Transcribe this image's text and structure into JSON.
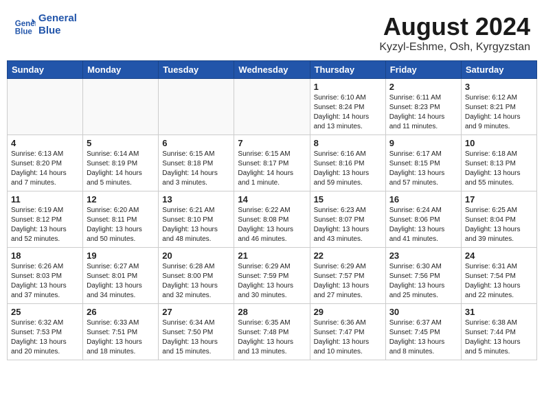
{
  "header": {
    "logo_line1": "General",
    "logo_line2": "Blue",
    "month_year": "August 2024",
    "location": "Kyzyl-Eshme, Osh, Kyrgyzstan"
  },
  "weekdays": [
    "Sunday",
    "Monday",
    "Tuesday",
    "Wednesday",
    "Thursday",
    "Friday",
    "Saturday"
  ],
  "weeks": [
    [
      {
        "day": "",
        "info": ""
      },
      {
        "day": "",
        "info": ""
      },
      {
        "day": "",
        "info": ""
      },
      {
        "day": "",
        "info": ""
      },
      {
        "day": "1",
        "info": "Sunrise: 6:10 AM\nSunset: 8:24 PM\nDaylight: 14 hours\nand 13 minutes."
      },
      {
        "day": "2",
        "info": "Sunrise: 6:11 AM\nSunset: 8:23 PM\nDaylight: 14 hours\nand 11 minutes."
      },
      {
        "day": "3",
        "info": "Sunrise: 6:12 AM\nSunset: 8:21 PM\nDaylight: 14 hours\nand 9 minutes."
      }
    ],
    [
      {
        "day": "4",
        "info": "Sunrise: 6:13 AM\nSunset: 8:20 PM\nDaylight: 14 hours\nand 7 minutes."
      },
      {
        "day": "5",
        "info": "Sunrise: 6:14 AM\nSunset: 8:19 PM\nDaylight: 14 hours\nand 5 minutes."
      },
      {
        "day": "6",
        "info": "Sunrise: 6:15 AM\nSunset: 8:18 PM\nDaylight: 14 hours\nand 3 minutes."
      },
      {
        "day": "7",
        "info": "Sunrise: 6:15 AM\nSunset: 8:17 PM\nDaylight: 14 hours\nand 1 minute."
      },
      {
        "day": "8",
        "info": "Sunrise: 6:16 AM\nSunset: 8:16 PM\nDaylight: 13 hours\nand 59 minutes."
      },
      {
        "day": "9",
        "info": "Sunrise: 6:17 AM\nSunset: 8:15 PM\nDaylight: 13 hours\nand 57 minutes."
      },
      {
        "day": "10",
        "info": "Sunrise: 6:18 AM\nSunset: 8:13 PM\nDaylight: 13 hours\nand 55 minutes."
      }
    ],
    [
      {
        "day": "11",
        "info": "Sunrise: 6:19 AM\nSunset: 8:12 PM\nDaylight: 13 hours\nand 52 minutes."
      },
      {
        "day": "12",
        "info": "Sunrise: 6:20 AM\nSunset: 8:11 PM\nDaylight: 13 hours\nand 50 minutes."
      },
      {
        "day": "13",
        "info": "Sunrise: 6:21 AM\nSunset: 8:10 PM\nDaylight: 13 hours\nand 48 minutes."
      },
      {
        "day": "14",
        "info": "Sunrise: 6:22 AM\nSunset: 8:08 PM\nDaylight: 13 hours\nand 46 minutes."
      },
      {
        "day": "15",
        "info": "Sunrise: 6:23 AM\nSunset: 8:07 PM\nDaylight: 13 hours\nand 43 minutes."
      },
      {
        "day": "16",
        "info": "Sunrise: 6:24 AM\nSunset: 8:06 PM\nDaylight: 13 hours\nand 41 minutes."
      },
      {
        "day": "17",
        "info": "Sunrise: 6:25 AM\nSunset: 8:04 PM\nDaylight: 13 hours\nand 39 minutes."
      }
    ],
    [
      {
        "day": "18",
        "info": "Sunrise: 6:26 AM\nSunset: 8:03 PM\nDaylight: 13 hours\nand 37 minutes."
      },
      {
        "day": "19",
        "info": "Sunrise: 6:27 AM\nSunset: 8:01 PM\nDaylight: 13 hours\nand 34 minutes."
      },
      {
        "day": "20",
        "info": "Sunrise: 6:28 AM\nSunset: 8:00 PM\nDaylight: 13 hours\nand 32 minutes."
      },
      {
        "day": "21",
        "info": "Sunrise: 6:29 AM\nSunset: 7:59 PM\nDaylight: 13 hours\nand 30 minutes."
      },
      {
        "day": "22",
        "info": "Sunrise: 6:29 AM\nSunset: 7:57 PM\nDaylight: 13 hours\nand 27 minutes."
      },
      {
        "day": "23",
        "info": "Sunrise: 6:30 AM\nSunset: 7:56 PM\nDaylight: 13 hours\nand 25 minutes."
      },
      {
        "day": "24",
        "info": "Sunrise: 6:31 AM\nSunset: 7:54 PM\nDaylight: 13 hours\nand 22 minutes."
      }
    ],
    [
      {
        "day": "25",
        "info": "Sunrise: 6:32 AM\nSunset: 7:53 PM\nDaylight: 13 hours\nand 20 minutes."
      },
      {
        "day": "26",
        "info": "Sunrise: 6:33 AM\nSunset: 7:51 PM\nDaylight: 13 hours\nand 18 minutes."
      },
      {
        "day": "27",
        "info": "Sunrise: 6:34 AM\nSunset: 7:50 PM\nDaylight: 13 hours\nand 15 minutes."
      },
      {
        "day": "28",
        "info": "Sunrise: 6:35 AM\nSunset: 7:48 PM\nDaylight: 13 hours\nand 13 minutes."
      },
      {
        "day": "29",
        "info": "Sunrise: 6:36 AM\nSunset: 7:47 PM\nDaylight: 13 hours\nand 10 minutes."
      },
      {
        "day": "30",
        "info": "Sunrise: 6:37 AM\nSunset: 7:45 PM\nDaylight: 13 hours\nand 8 minutes."
      },
      {
        "day": "31",
        "info": "Sunrise: 6:38 AM\nSunset: 7:44 PM\nDaylight: 13 hours\nand 5 minutes."
      }
    ]
  ]
}
